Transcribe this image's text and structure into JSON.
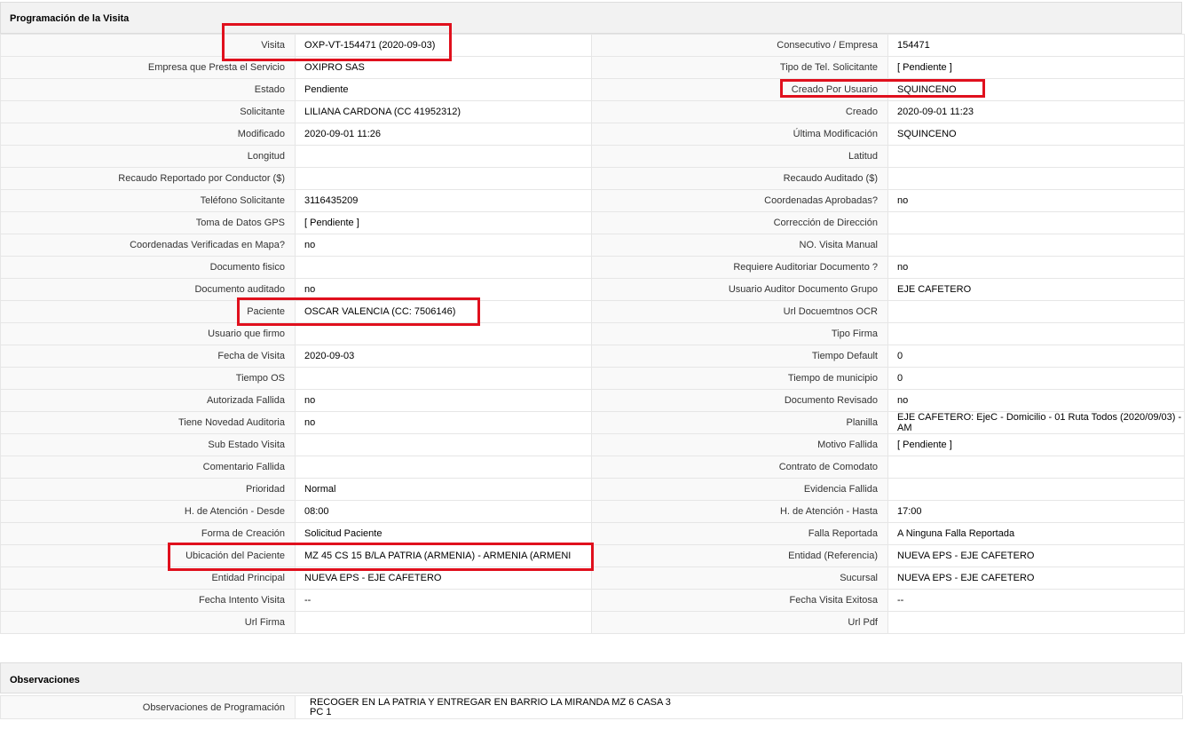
{
  "sections": {
    "programacion": "Programación de la Visita",
    "observaciones": "Observaciones"
  },
  "rows": [
    {
      "l1": "Visita",
      "v1": "OXP-VT-154471 (2020-09-03)",
      "l2": "Consecutivo / Empresa",
      "v2": "154471"
    },
    {
      "l1": "Empresa que Presta el Servicio",
      "v1": "OXIPRO SAS",
      "l2": "Tipo de Tel. Solicitante",
      "v2": "[ Pendiente ]"
    },
    {
      "l1": "Estado",
      "v1": "Pendiente",
      "l2": "Creado Por Usuario",
      "v2": "SQUINCENO"
    },
    {
      "l1": "Solicitante",
      "v1": "LILIANA CARDONA (CC 41952312)",
      "l2": "Creado",
      "v2": "2020-09-01 11:23"
    },
    {
      "l1": "Modificado",
      "v1": "2020-09-01 11:26",
      "l2": "Última Modificación",
      "v2": "SQUINCENO"
    },
    {
      "l1": "Longitud",
      "v1": "",
      "l2": "Latitud",
      "v2": ""
    },
    {
      "l1": "Recaudo Reportado por Conductor ($)",
      "v1": "",
      "l2": "Recaudo Auditado ($)",
      "v2": ""
    },
    {
      "l1": "Teléfono Solicitante",
      "v1": "3116435209",
      "l2": "Coordenadas Aprobadas?",
      "v2": "no"
    },
    {
      "l1": "Toma de Datos GPS",
      "v1": "[ Pendiente ]",
      "l2": "Corrección de Dirección",
      "v2": ""
    },
    {
      "l1": "Coordenadas Verificadas en Mapa?",
      "v1": "no",
      "l2": "NO. Visita Manual",
      "v2": ""
    },
    {
      "l1": "Documento fisico",
      "v1": "",
      "l2": "Requiere Auditoriar Documento ?",
      "v2": "no"
    },
    {
      "l1": "Documento auditado",
      "v1": "no",
      "l2": "Usuario Auditor Documento Grupo",
      "v2": "EJE CAFETERO"
    },
    {
      "l1": "Paciente",
      "v1": "OSCAR VALENCIA (CC: 7506146)",
      "l2": "Url Docuemtnos OCR",
      "v2": ""
    },
    {
      "l1": "Usuario que firmo",
      "v1": "",
      "l2": "Tipo Firma",
      "v2": ""
    },
    {
      "l1": "Fecha de Visita",
      "v1": "2020-09-03",
      "l2": "Tiempo Default",
      "v2": "0"
    },
    {
      "l1": "Tiempo OS",
      "v1": "",
      "l2": "Tiempo de municipio",
      "v2": "0"
    },
    {
      "l1": "Autorizada Fallida",
      "v1": "no",
      "l2": "Documento Revisado",
      "v2": "no"
    },
    {
      "l1": "Tiene Novedad Auditoria",
      "v1": "no",
      "l2": "Planilla",
      "v2": "EJE CAFETERO: EjeC - Domicilio - 01 Ruta Todos (2020/09/03) - AM"
    },
    {
      "l1": "Sub Estado Visita",
      "v1": "",
      "l2": "Motivo Fallida",
      "v2": "[ Pendiente ]"
    },
    {
      "l1": "Comentario Fallida",
      "v1": "",
      "l2": "Contrato de Comodato",
      "v2": ""
    },
    {
      "l1": "Prioridad",
      "v1": "Normal",
      "l2": "Evidencia Fallida",
      "v2": ""
    },
    {
      "l1": "H. de Atención - Desde",
      "v1": "08:00",
      "l2": "H. de Atención - Hasta",
      "v2": "17:00"
    },
    {
      "l1": "Forma de Creación",
      "v1": "Solicitud Paciente",
      "l2": "Falla Reportada",
      "v2": "A Ninguna Falla Reportada"
    },
    {
      "l1": "Ubicación del Paciente",
      "v1": "MZ 45 CS 15 B/LA PATRIA (ARMENIA) - ARMENIA (ARMENI",
      "l2": "Entidad (Referencia)",
      "v2": "NUEVA EPS - EJE CAFETERO"
    },
    {
      "l1": "Entidad Principal",
      "v1": "NUEVA EPS - EJE CAFETERO",
      "l2": "Sucursal",
      "v2": "NUEVA EPS - EJE CAFETERO"
    },
    {
      "l1": "Fecha Intento Visita",
      "v1": "--",
      "l2": "Fecha Visita Exitosa",
      "v2": "--"
    },
    {
      "l1": "Url Firma",
      "v1": "",
      "l2": "Url Pdf",
      "v2": ""
    }
  ],
  "observaciones": {
    "label": "Observaciones de Programación",
    "value": "RECOGER EN LA PATRIA Y ENTREGAR EN BARRIO LA MIRANDA MZ 6 CASA 3 PC 1"
  },
  "highlight_color": "#e0101d"
}
